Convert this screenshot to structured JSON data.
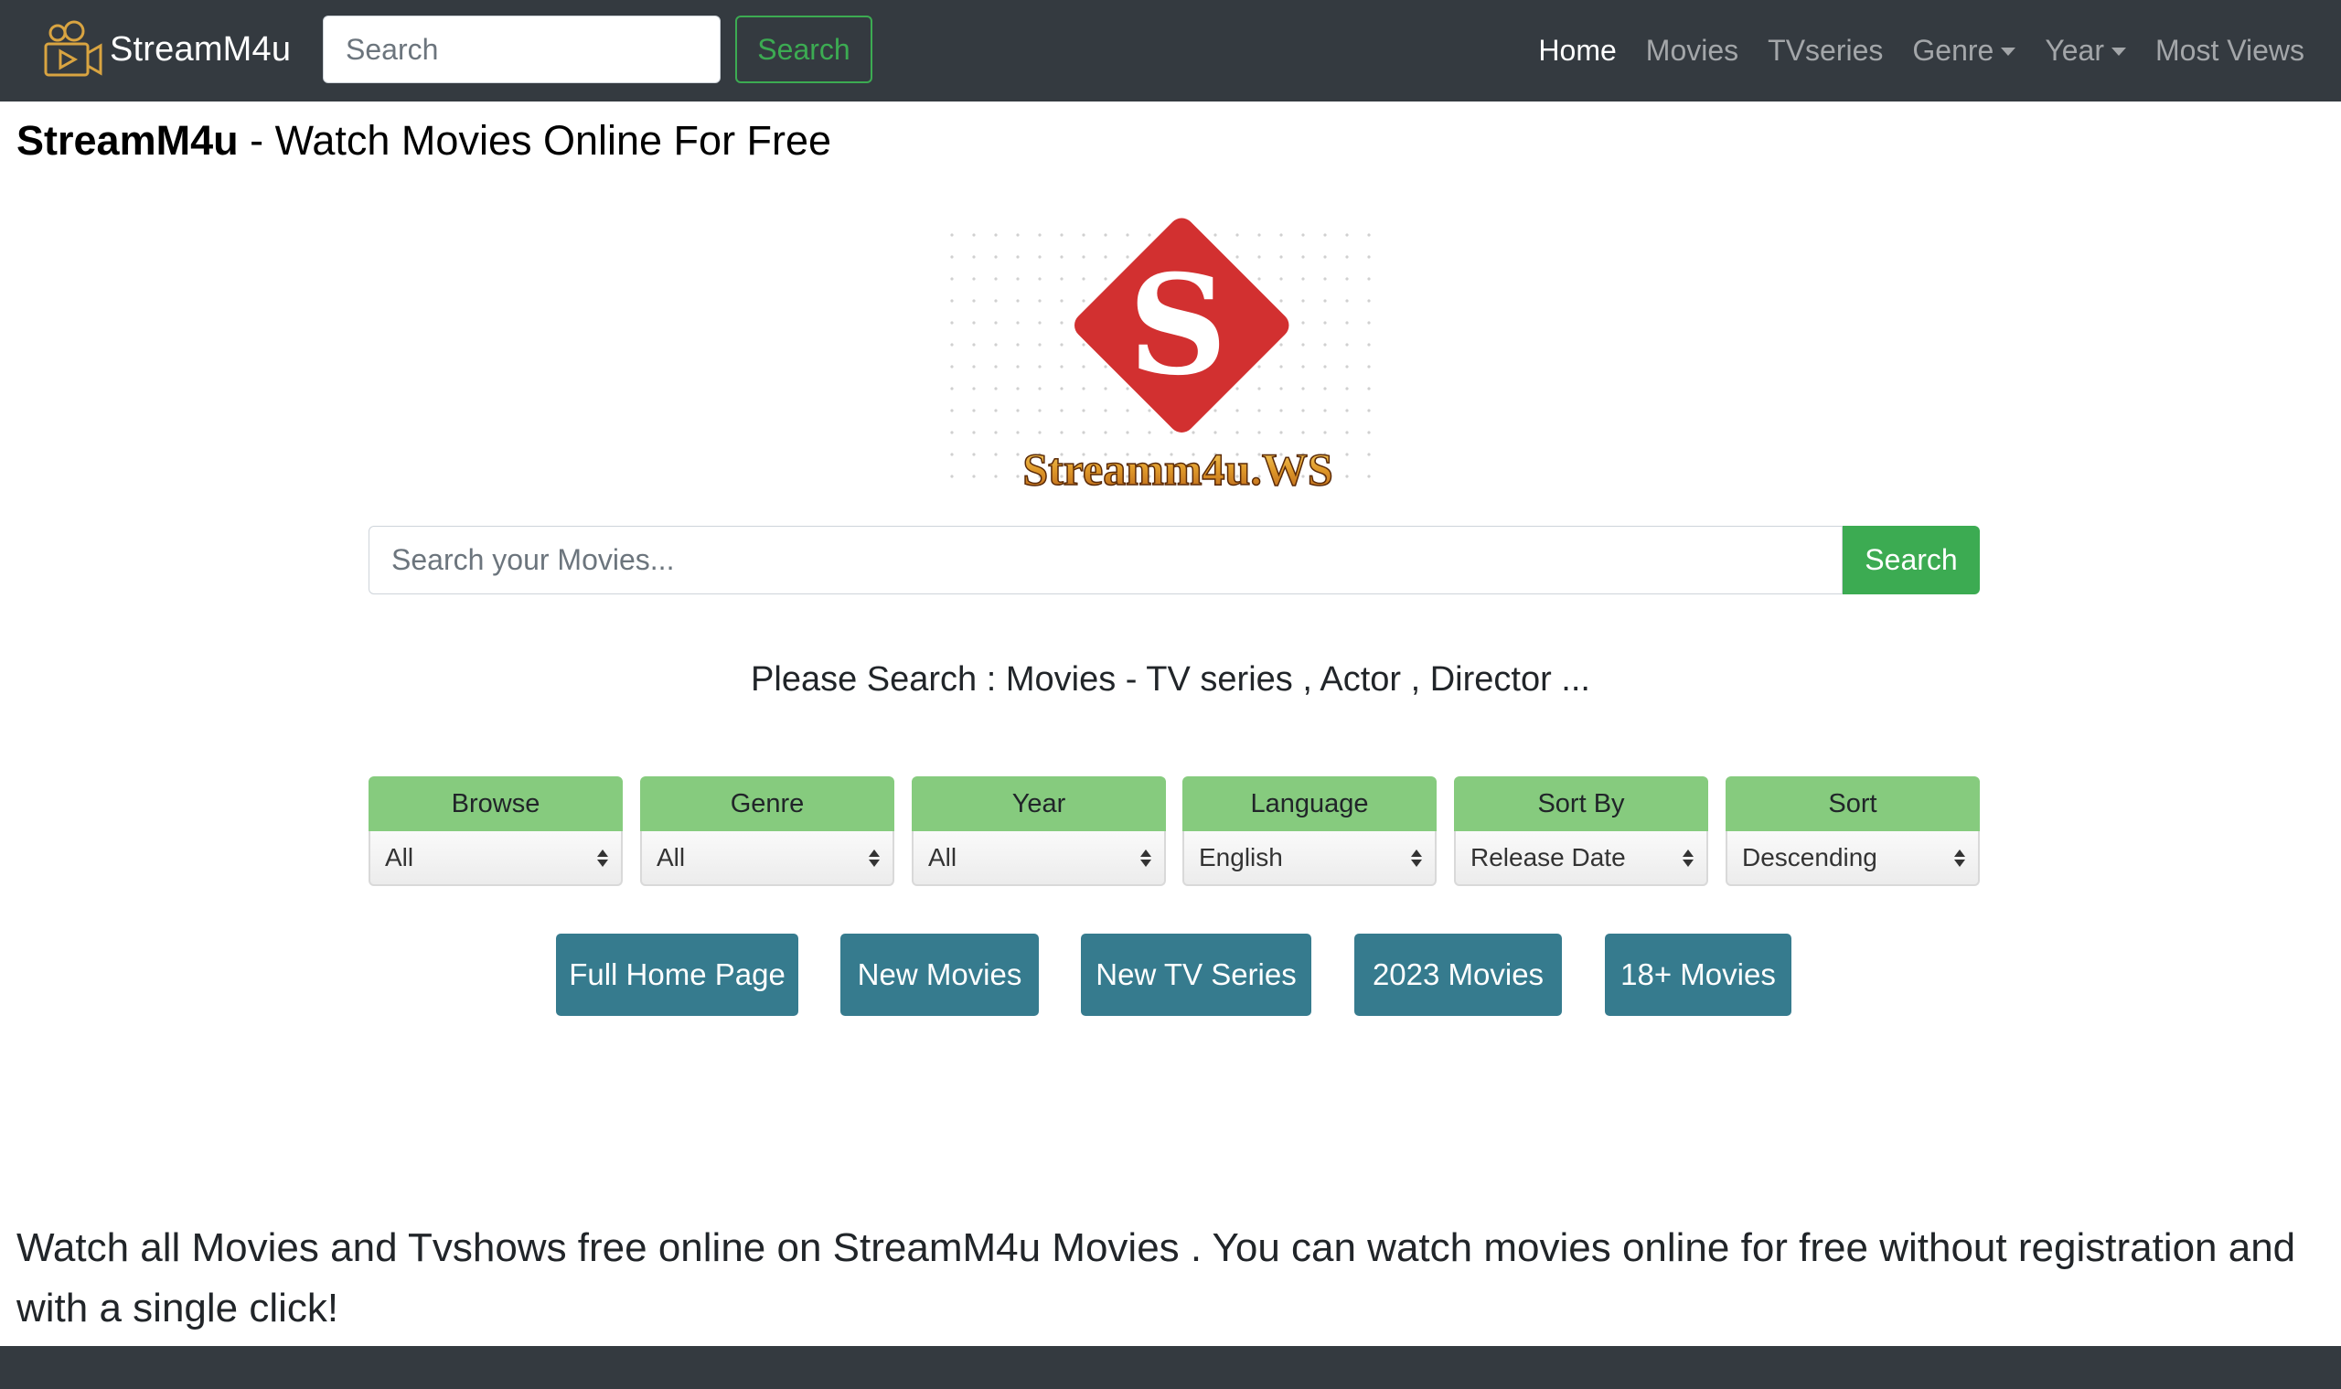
{
  "navbar": {
    "brand": "StreamM4u",
    "search_placeholder": "Search",
    "search_button": "Search",
    "links": [
      {
        "label": "Home",
        "active": true
      },
      {
        "label": "Movies"
      },
      {
        "label": "TVseries"
      },
      {
        "label": "Genre",
        "dropdown": true
      },
      {
        "label": "Year",
        "dropdown": true
      },
      {
        "label": "Most Views"
      }
    ]
  },
  "heading": {
    "brand": "StreamM4u",
    "rest": " - Watch Movies Online For Free"
  },
  "logo": {
    "letter": "S",
    "wordmark": "Streamm4u.WS"
  },
  "main_search": {
    "placeholder": "Search your Movies...",
    "button": "Search"
  },
  "hint": "Please Search : Movies - TV series , Actor , Director ...",
  "filters": [
    {
      "label": "Browse",
      "value": "All"
    },
    {
      "label": "Genre",
      "value": "All"
    },
    {
      "label": "Year",
      "value": "All"
    },
    {
      "label": "Language",
      "value": "English"
    },
    {
      "label": "Sort By",
      "value": "Release Date"
    },
    {
      "label": "Sort",
      "value": "Descending"
    }
  ],
  "quick_links": [
    "Full Home Page",
    "New Movies",
    "New TV Series",
    "2023 Movies",
    "18+ Movies"
  ],
  "footer_text": "Watch all Movies and Tvshows free online on StreamM4u Movies . You can watch movies online for free without registration and with a single click!",
  "colors": {
    "navbar": "#343a40",
    "accent_green": "#3cab52",
    "filter_green": "#86cb7e",
    "quick_link_teal": "#367b8e",
    "logo_red": "#d23030"
  }
}
